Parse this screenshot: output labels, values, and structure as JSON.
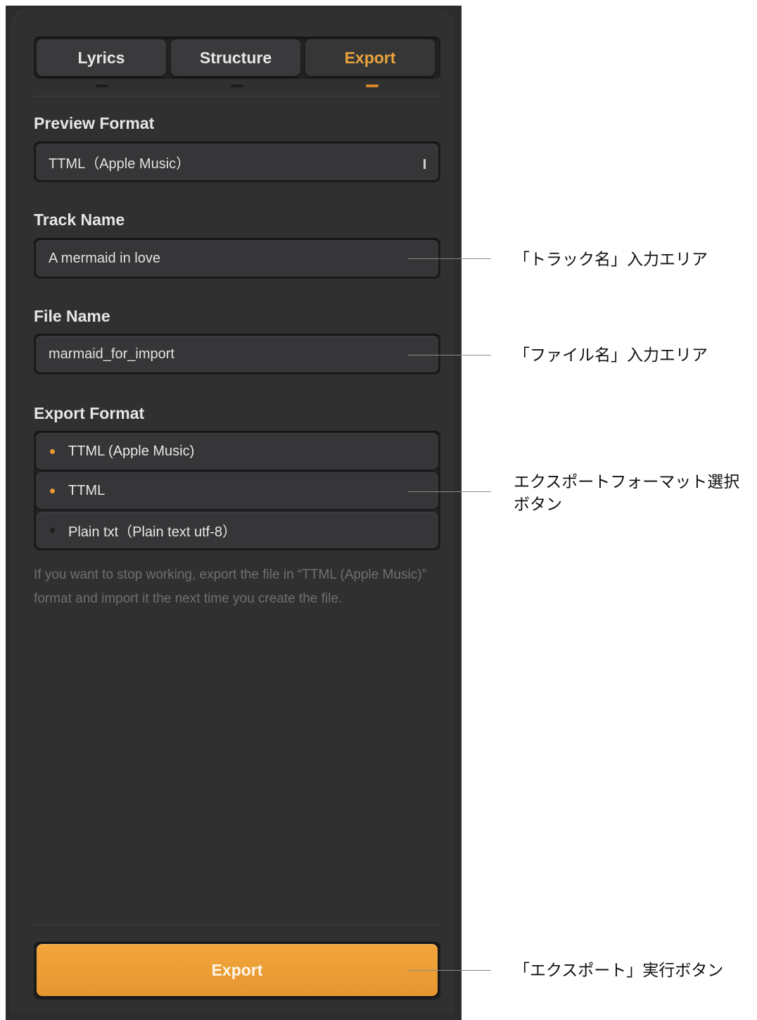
{
  "tabs": [
    {
      "label": "Lyrics",
      "active": false
    },
    {
      "label": "Structure",
      "active": false
    },
    {
      "label": "Export",
      "active": true
    }
  ],
  "preview_format": {
    "label": "Preview Format",
    "value": "TTML（Apple Music）"
  },
  "track_name": {
    "label": "Track Name",
    "value": "A mermaid in love"
  },
  "file_name": {
    "label": "File Name",
    "value": "marmaid_for_import"
  },
  "export_format": {
    "label": "Export Format",
    "options": [
      {
        "label": "TTML (Apple Music)",
        "selected": true
      },
      {
        "label": "TTML",
        "selected": true
      },
      {
        "label": "Plain txt（Plain text utf-8）",
        "selected": false
      }
    ]
  },
  "hint": "If you want to stop working, export the file in “TTML (Apple Music)” format and import it the next time you create the file.",
  "export_button": "Export",
  "callouts": {
    "track_name": "「トラック名」入力エリア",
    "file_name": "「ファイル名」入力エリア",
    "export_format_line1": "エクスポートフォーマット選択",
    "export_format_line2": "ボタン",
    "export_button": "「エクスポート」実行ボタン"
  },
  "colors": {
    "accent": "#e8982e",
    "panel": "#303031",
    "text": "#e6e6e6"
  }
}
